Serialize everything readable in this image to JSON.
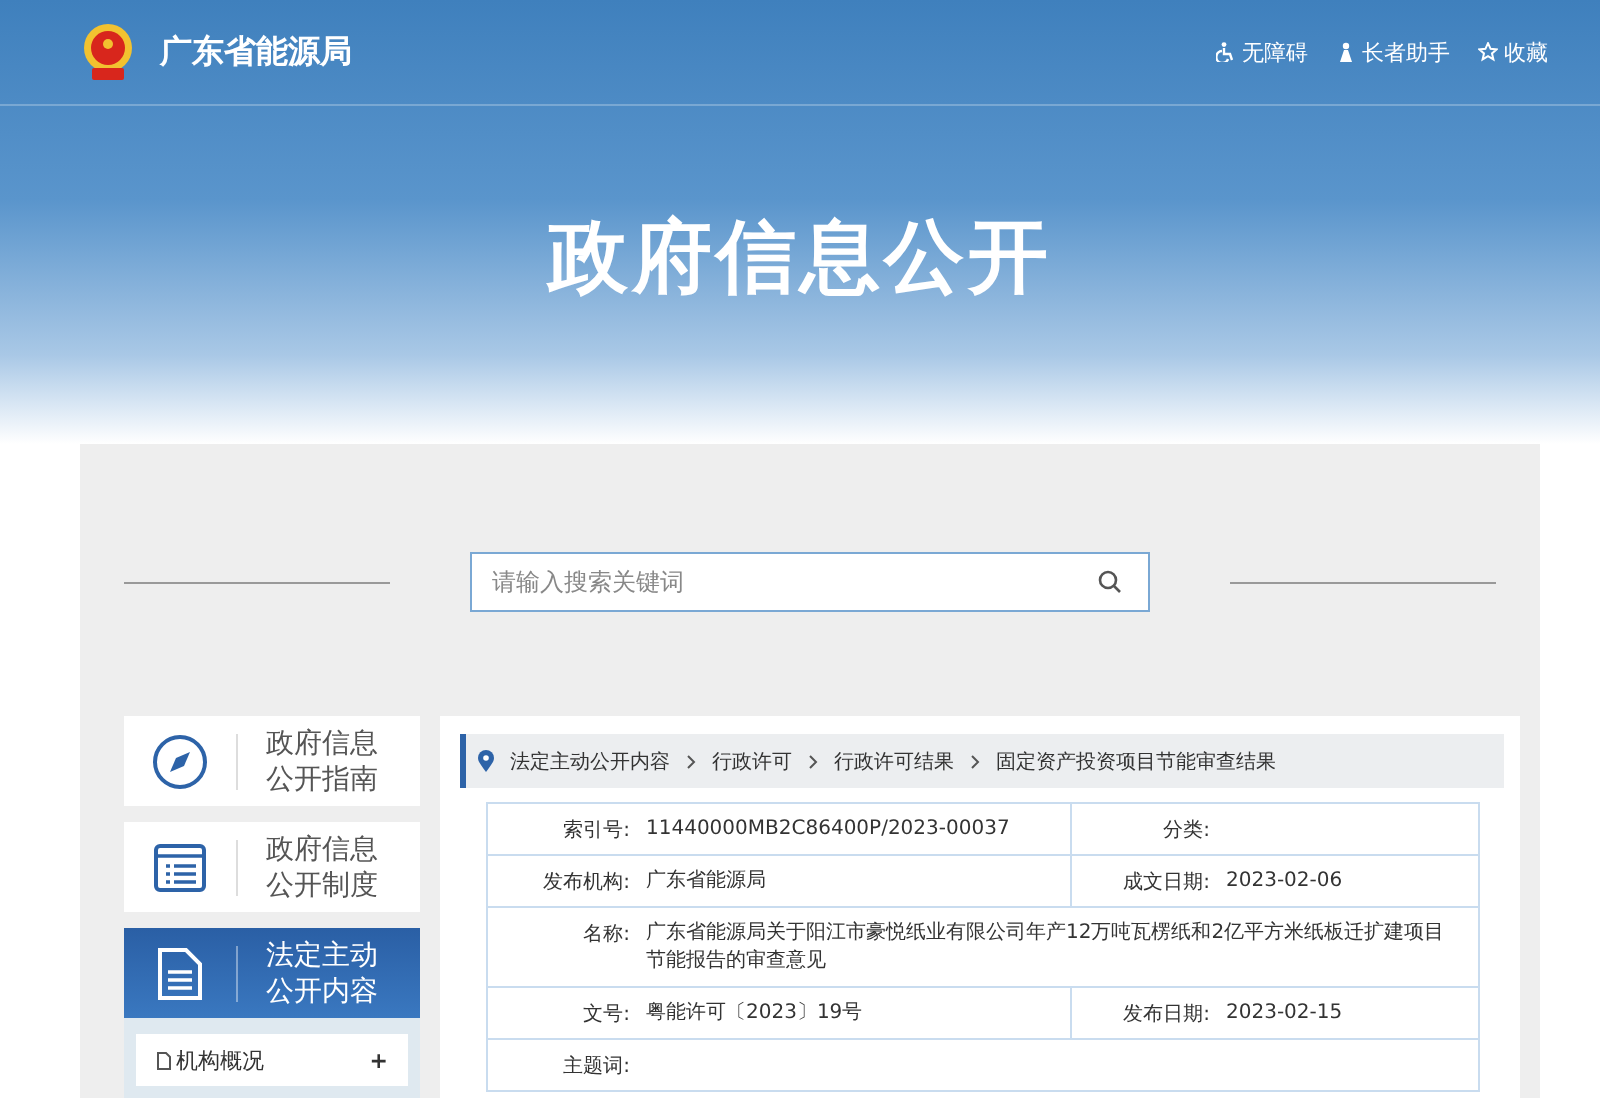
{
  "header": {
    "site_name": "广东省能源局",
    "links": [
      {
        "kind": "accessibility",
        "label": "无障碍"
      },
      {
        "kind": "elder",
        "label": "长者助手"
      },
      {
        "kind": "favorite",
        "label": "收藏"
      }
    ]
  },
  "banner": {
    "title": "政府信息公开"
  },
  "search": {
    "placeholder": "请输入搜索关键词"
  },
  "sidebar": {
    "items": [
      {
        "kind": "compass",
        "label": "政府信息公开指南",
        "selected": false
      },
      {
        "kind": "list",
        "label": "政府信息公开制度",
        "selected": false
      },
      {
        "kind": "document",
        "label": "法定主动公开内容",
        "selected": true
      }
    ],
    "submenu": [
      {
        "label": "机构概况",
        "toggle": "+"
      }
    ]
  },
  "breadcrumb": [
    "法定主动公开内容",
    "行政许可",
    "行政许可结果",
    "固定资产投资项目节能审查结果"
  ],
  "table": {
    "rows": [
      {
        "kind": "pair",
        "cells": [
          {
            "label": "索引号:",
            "value": "11440000MB2C86400P/2023-00037"
          },
          {
            "label": "分类:"
          }
        ]
      },
      {
        "kind": "pair",
        "cells": [
          {
            "label": "发布机构:",
            "value": "广东省能源局"
          },
          {
            "label": "成文日期:",
            "value": "2023-02-06"
          }
        ]
      },
      {
        "kind": "full",
        "cells": [
          {
            "label": "名称:",
            "value": "广东省能源局关于阳江市豪悦纸业有限公司年产12万吨瓦楞纸和2亿平方米纸板迁扩建项目节能报告的审查意见"
          }
        ]
      },
      {
        "kind": "pair",
        "cells": [
          {
            "label": "文号:",
            "value": "粤能许可〔2023〕19号"
          },
          {
            "label": "发布日期:",
            "value": "2023-02-15"
          }
        ]
      },
      {
        "kind": "full",
        "cells": [
          {
            "label": "主题词:"
          }
        ]
      }
    ]
  }
}
